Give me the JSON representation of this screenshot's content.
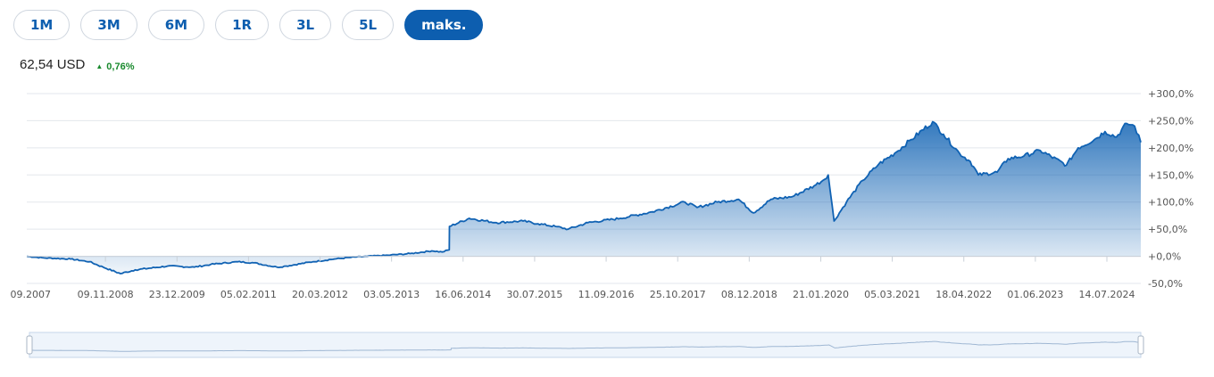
{
  "range_buttons": [
    {
      "label": "1M",
      "active": false
    },
    {
      "label": "3M",
      "active": false
    },
    {
      "label": "6M",
      "active": false
    },
    {
      "label": "1R",
      "active": false
    },
    {
      "label": "3L",
      "active": false
    },
    {
      "label": "5L",
      "active": false
    },
    {
      "label": "maks.",
      "active": true
    }
  ],
  "quote": {
    "price": "62,54 USD",
    "change": "0,76%",
    "direction": "up"
  },
  "colors": {
    "accent": "#0d5eaf",
    "line": "#1062b3",
    "positive": "#1a8a2e",
    "grid": "#e3e7ec"
  },
  "chart_data": {
    "type": "area",
    "title": "",
    "xlabel": "",
    "ylabel": "",
    "y_unit": "%",
    "ylim": [
      -50,
      300
    ],
    "y_ticks": [
      -50,
      0,
      50,
      100,
      150,
      200,
      250,
      300
    ],
    "y_tick_labels": [
      "-50,0%",
      "+0,0%",
      "+50,0%",
      "+100,0%",
      "+150,0%",
      "+200,0%",
      "+250,0%",
      "+300,0%"
    ],
    "x_tick_labels": [
      "09.2007",
      "09.11.2008",
      "23.12.2009",
      "05.02.2011",
      "20.03.2012",
      "03.05.2013",
      "16.06.2014",
      "30.07.2015",
      "11.09.2016",
      "25.10.2017",
      "08.12.2018",
      "21.01.2020",
      "05.03.2021",
      "18.04.2022",
      "01.06.2023",
      "14.07.2024"
    ],
    "grid": true,
    "legend": "none",
    "series": [
      {
        "x": [
          "2007-09-27",
          "2008-01-01",
          "2008-06-01",
          "2008-09-15",
          "2008-12-01",
          "2009-03-09",
          "2009-06-01",
          "2009-12-01",
          "2010-05-01",
          "2010-08-01",
          "2011-01-01",
          "2011-04-01",
          "2011-08-10",
          "2011-10-01",
          "2012-03-01",
          "2012-07-01",
          "2012-10-01",
          "2013-01-01",
          "2013-05-01",
          "2013-09-01",
          "2014-01-01",
          "2014-03-01",
          "2014-04-10",
          "2014-04-11",
          "2014-08-01",
          "2015-01-01",
          "2015-06-01",
          "2015-08-24",
          "2015-12-01",
          "2016-02-11",
          "2016-06-01",
          "2016-12-01",
          "2017-06-01",
          "2017-12-01",
          "2018-02-08",
          "2018-06-01",
          "2018-10-01",
          "2018-12-24",
          "2019-04-01",
          "2019-08-01",
          "2019-12-01",
          "2020-01-20",
          "2020-02-19",
          "2020-03-23",
          "2020-06-01",
          "2020-09-01",
          "2020-12-01",
          "2021-03-01",
          "2021-06-01",
          "2021-10-01",
          "2021-12-01",
          "2022-03-01",
          "2022-05-01",
          "2022-06-16",
          "2022-09-30",
          "2022-12-01",
          "2023-03-01",
          "2023-06-01",
          "2023-10-27",
          "2024-01-01",
          "2024-04-01",
          "2024-06-01",
          "2024-08-05",
          "2024-10-01",
          "2024-11-15",
          "2024-12-20"
        ],
        "y": [
          0,
          -3,
          -5,
          -10,
          -20,
          -32,
          -25,
          -18,
          -20,
          -15,
          -10,
          -12,
          -20,
          -18,
          -10,
          -5,
          -2,
          0,
          2,
          5,
          10,
          8,
          12,
          55,
          70,
          62,
          65,
          60,
          55,
          50,
          62,
          70,
          82,
          100,
          90,
          100,
          105,
          80,
          105,
          110,
          130,
          140,
          150,
          65,
          100,
          140,
          170,
          190,
          215,
          248,
          225,
          190,
          175,
          150,
          155,
          180,
          185,
          195,
          168,
          200,
          215,
          230,
          220,
          245,
          240,
          210
        ]
      }
    ]
  }
}
